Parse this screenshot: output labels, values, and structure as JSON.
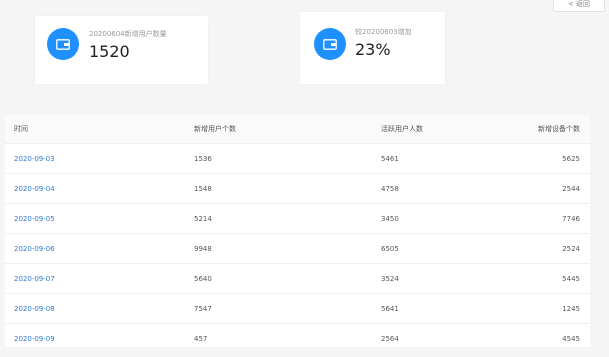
{
  "back": {
    "label": "< 返回"
  },
  "stats": [
    {
      "label": "20200604新增用户数量",
      "value": "1520",
      "icon": "wallet-icon"
    },
    {
      "label": "较20200603增加",
      "value": "23%",
      "icon": "wallet-icon"
    }
  ],
  "table": {
    "headers": [
      "时间",
      "新增用户个数",
      "活跃用户人数",
      "新增设备个数"
    ],
    "rows": [
      [
        "2020-09-03",
        "1536",
        "5461",
        "5625"
      ],
      [
        "2020-09-04",
        "1548",
        "4758",
        "2544"
      ],
      [
        "2020-09-05",
        "5214",
        "3450",
        "7746"
      ],
      [
        "2020-09-06",
        "9948",
        "6505",
        "2524"
      ],
      [
        "2020-09-07",
        "5640",
        "3524",
        "5445"
      ],
      [
        "2020-09-08",
        "7547",
        "5641",
        "1245"
      ],
      [
        "2020-09-09",
        "457",
        "2564",
        "4545"
      ]
    ]
  }
}
